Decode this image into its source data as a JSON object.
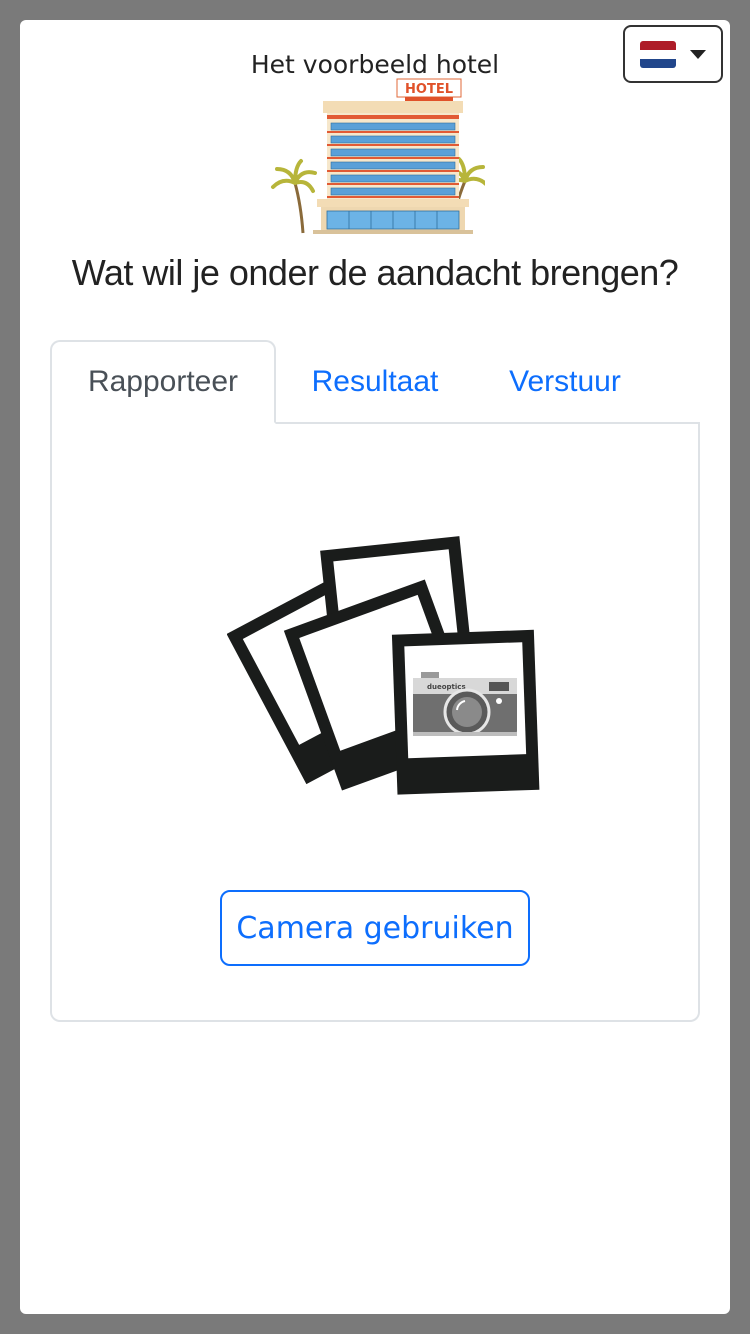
{
  "header": {
    "hotel_name": "Het voorbeeld hotel",
    "logo_sign": "HOTEL"
  },
  "language": {
    "selected": "nl-flag-icon",
    "flag_colors": [
      "#ae1c28",
      "#ffffff",
      "#21468b"
    ]
  },
  "question": "Wat wil je onder de aandacht brengen?",
  "tabs": [
    {
      "label": "Rapporteer",
      "active": true
    },
    {
      "label": "Resultaat",
      "active": false
    },
    {
      "label": "Verstuur",
      "active": false
    }
  ],
  "panel": {
    "illustration": "photos-camera-icon",
    "camera_brand": "dueoptics",
    "camera_button_label": "Camera gebruiken"
  },
  "colors": {
    "accent": "#0d6efd",
    "border": "#dee2e6",
    "background": "#7a7a7a"
  }
}
